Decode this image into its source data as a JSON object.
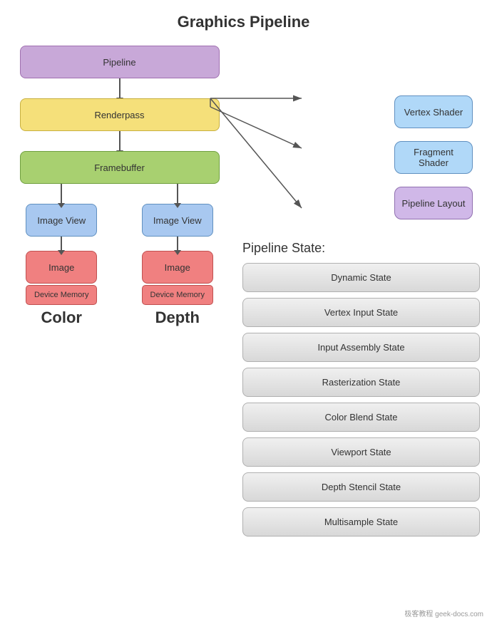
{
  "title": "Graphics Pipeline",
  "left": {
    "pipeline_label": "Pipeline",
    "renderpass_label": "Renderpass",
    "framebuffer_label": "Framebuffer",
    "imageview_label": "Image View",
    "image_label": "Image",
    "devmem_label": "Device Memory",
    "color_label": "Color",
    "depth_label": "Depth"
  },
  "right": {
    "shaders": {
      "vertex": "Vertex Shader",
      "fragment": "Fragment Shader",
      "layout": "Pipeline Layout"
    },
    "pipeline_state_title": "Pipeline State:",
    "states": [
      "Dynamic State",
      "Vertex Input State",
      "Input Assembly State",
      "Rasterization State",
      "Color Blend State",
      "Viewport State",
      "Depth Stencil State",
      "Multisample State"
    ]
  },
  "watermark": "极客教程 geek-docs.com"
}
